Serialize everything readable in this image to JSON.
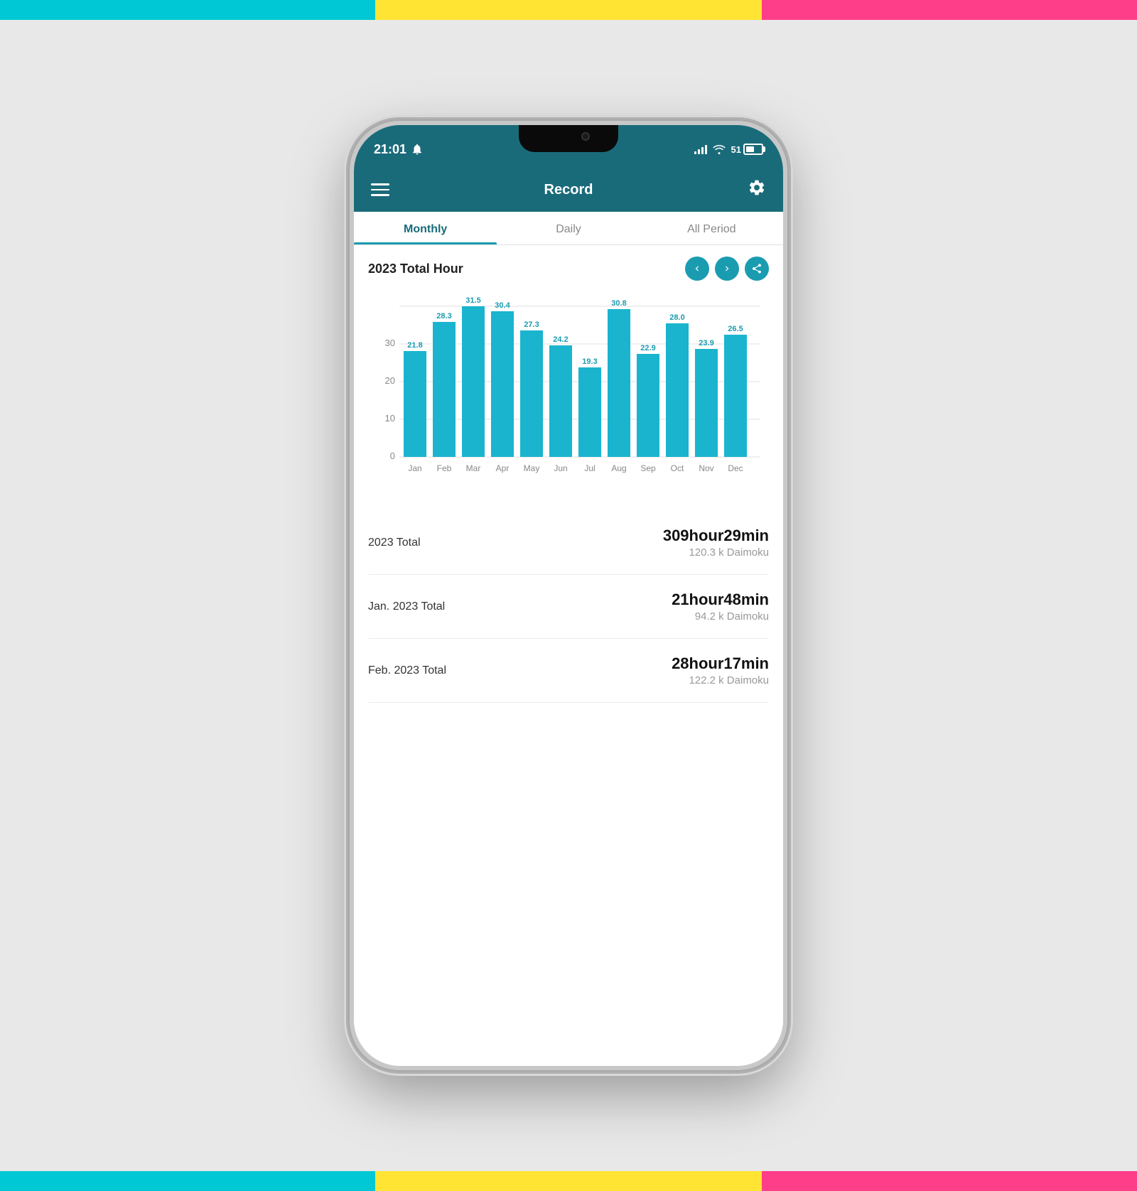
{
  "page": {
    "bg_colors": {
      "cyan": "#00C8D4",
      "yellow": "#FFE433",
      "pink": "#FF3E8A"
    }
  },
  "status_bar": {
    "time": "21:01",
    "battery_level": "51"
  },
  "header": {
    "title": "Record"
  },
  "tabs": [
    {
      "id": "monthly",
      "label": "Monthly",
      "active": true
    },
    {
      "id": "daily",
      "label": "Daily",
      "active": false
    },
    {
      "id": "all_period",
      "label": "All Period",
      "active": false
    }
  ],
  "chart": {
    "title": "2023 Total Hour",
    "y_axis_labels": [
      "0",
      "10",
      "20",
      "30"
    ],
    "months": [
      "Jan",
      "Feb",
      "Mar",
      "Apr",
      "May",
      "Jun",
      "Jul",
      "Aug",
      "Sep",
      "Oct",
      "Nov",
      "Dec"
    ],
    "values": [
      21.8,
      28.3,
      31.5,
      30.4,
      27.3,
      24.2,
      19.3,
      30.8,
      22.9,
      28.0,
      23.9,
      26.5
    ],
    "bar_color": "#1ab4cf",
    "max_value": 35
  },
  "stats": [
    {
      "label": "2023 Total",
      "main": "309hour29min",
      "sub": "120.3 k Daimoku"
    },
    {
      "label": "Jan. 2023 Total",
      "main": "21hour48min",
      "sub": "94.2 k Daimoku"
    },
    {
      "label": "Feb. 2023 Total",
      "main": "28hour17min",
      "sub": "122.2 k Daimoku"
    }
  ]
}
